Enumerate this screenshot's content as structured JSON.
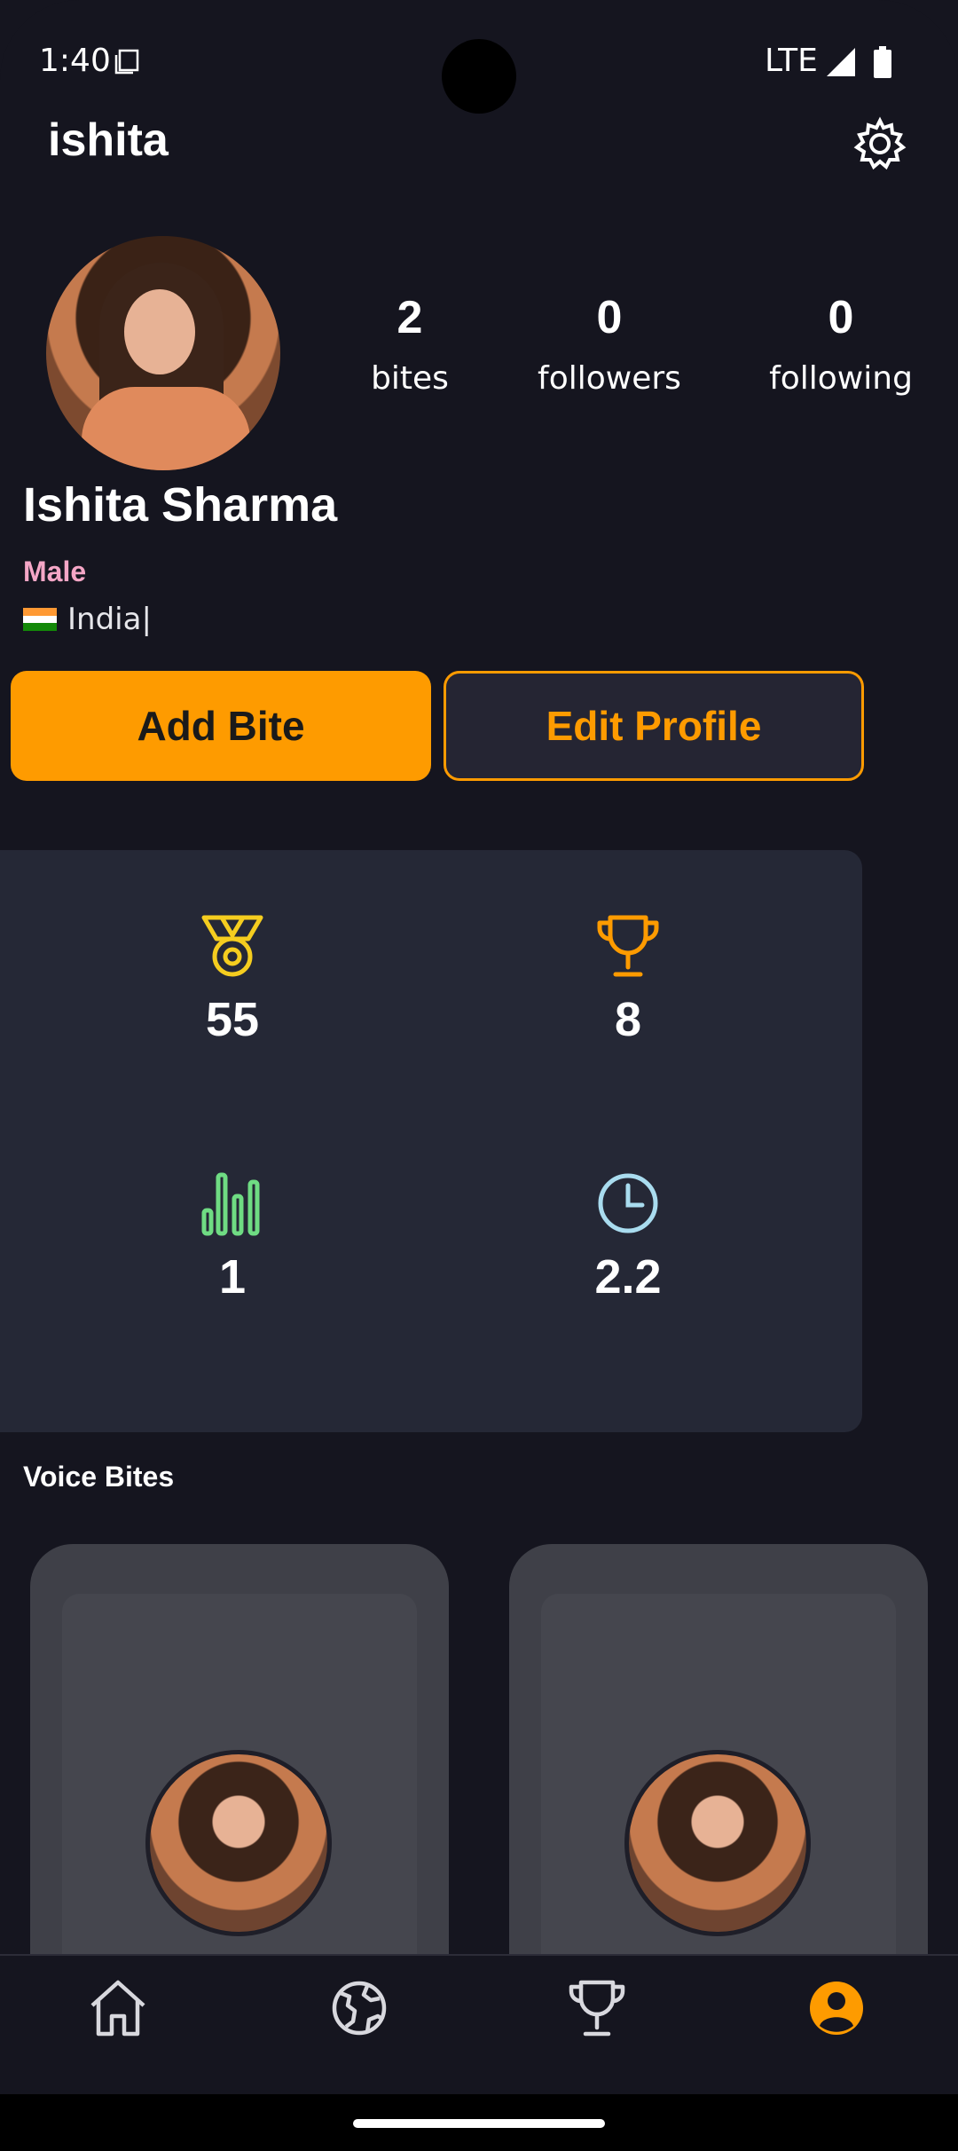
{
  "status_bar": {
    "time": "1:40",
    "network": "LTE"
  },
  "header": {
    "username": "ishita",
    "settings_icon": "gear-icon"
  },
  "profile": {
    "stats": [
      {
        "value": "2",
        "label": "bites"
      },
      {
        "value": "0",
        "label": "followers"
      },
      {
        "value": "0",
        "label": "following"
      }
    ],
    "full_name": "Ishita Sharma",
    "gender": "Male",
    "country": "India|"
  },
  "actions": {
    "add_bite": "Add Bite",
    "edit_profile": "Edit Profile"
  },
  "metrics": [
    {
      "icon": "medal-icon",
      "value": "55",
      "color": "#f5cd1f"
    },
    {
      "icon": "trophy-icon",
      "value": "8",
      "color": "#fe9b00"
    },
    {
      "icon": "bar-chart-icon",
      "value": "1",
      "color": "#6fdc83"
    },
    {
      "icon": "clock-icon",
      "value": "2.2",
      "color": "#a9dcef"
    }
  ],
  "section": {
    "voice_bites_title": "Voice Bites"
  },
  "bottom_nav": {
    "items": [
      {
        "icon": "home-icon",
        "active": false
      },
      {
        "icon": "globe-icon",
        "active": false
      },
      {
        "icon": "trophy-icon",
        "active": false
      },
      {
        "icon": "profile-icon",
        "active": true
      }
    ],
    "accent": "#fe9b00"
  }
}
